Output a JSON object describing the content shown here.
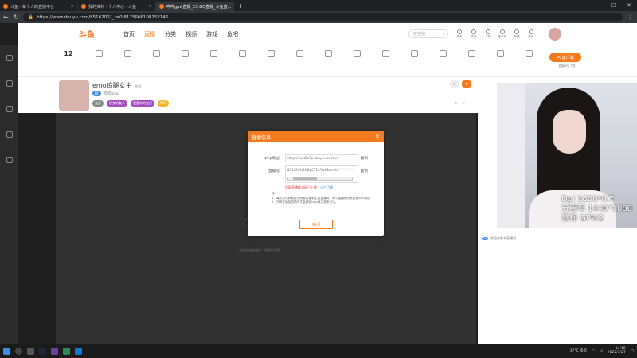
{
  "browser": {
    "tabs": [
      {
        "title": "斗鱼 - 每个人的直播平台",
        "active": false
      },
      {
        "title": "我的资料 - 个人中心 - 斗鱼",
        "active": false
      },
      {
        "title": "哔哔gpw直播_CS:GO直播_斗鱼直...",
        "active": true
      }
    ],
    "url": "https://www.douyu.com/8516200?_r=0.8125666108152146"
  },
  "site": {
    "logo": "斗鱼",
    "nav": [
      "首页",
      "直播",
      "分类",
      "视频",
      "游戏",
      "鱼吧"
    ],
    "search_placeholder": "搜主播",
    "top_icons": [
      "历史",
      "关注",
      "下载",
      "客户端",
      "开播",
      "任务"
    ]
  },
  "toolbar": {
    "count": "12",
    "pc_button": "PC客户端",
    "pc_label": "直播伴侣下载"
  },
  "room": {
    "title": "emo追腿女主",
    "title_tags": "举报",
    "sub_info": "哔哔gpw",
    "badges": [
      "宝贝",
      "摇曳的女人",
      "我是你的宝贝",
      "999"
    ]
  },
  "player": {
    "loading_text": "主播正在准备中，请稍后观看"
  },
  "chat": {
    "welcome": "欢迎来到本直播间"
  },
  "overlay": {
    "line1": "Dpi 1600*0.7",
    "line2": "分辨率 1440*1080",
    "line3": "鼠标 GPW2"
  },
  "modal": {
    "title": "直播信息",
    "rtmp_label": "rtmp地址：",
    "rtmp_value": "rtmp://sendtc3a.douyu.com/live",
    "key_label": "直播码：",
    "key_value": "8516200r1KDpCT1u7wxSacrets**********",
    "copy": "复制",
    "warn": "获取直播推流码已上线",
    "warn_link": "点击了解",
    "notes_title": "注：",
    "note1": "1、每次点击获取推流码都会重新生成直播码，每个直播码的有效期为5分钟。",
    "note2": "2、只有在抽奖流填写才会得到tmp地址发来已化。",
    "ok": "关闭"
  },
  "taskbar": {
    "temp": "37°C 多云",
    "time": "14:16",
    "date": "2022/7/27"
  }
}
